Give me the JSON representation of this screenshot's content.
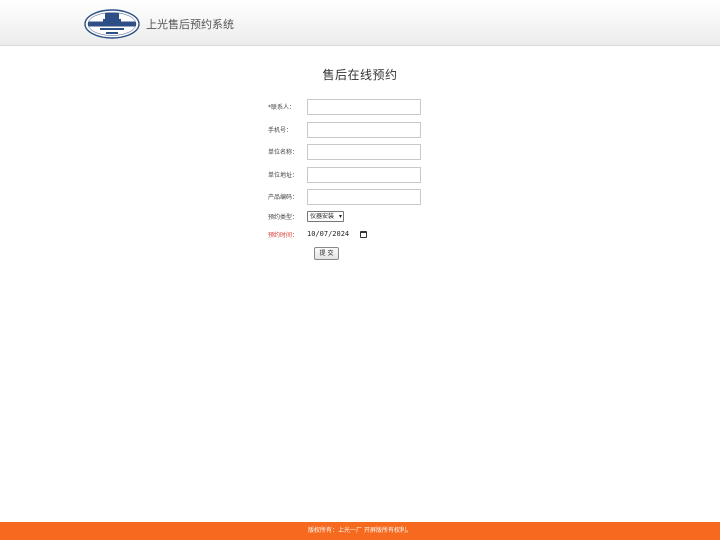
{
  "header": {
    "app_title": "上光售后预约系统",
    "logo_icon": "shanghai-optical-logo"
  },
  "form": {
    "title": "售后在线预约",
    "fields": [
      {
        "label": "*联系人：",
        "value": ""
      },
      {
        "label": "手机号：",
        "value": ""
      },
      {
        "label": "单位名称：",
        "value": ""
      },
      {
        "label": "单位地址：",
        "value": ""
      },
      {
        "label": "产品编码：",
        "value": ""
      }
    ],
    "type_label": "预约类型：",
    "type_selected": "仪器安装",
    "time_label": "预约时间：",
    "time_value": "10/07/2024",
    "submit_label": "提 交"
  },
  "footer": {
    "text": "版权所有：上光一厂   开屏版所有权利。"
  },
  "colors": {
    "footer_bg": "#f56a1f",
    "required_label": "#d63a2a"
  }
}
